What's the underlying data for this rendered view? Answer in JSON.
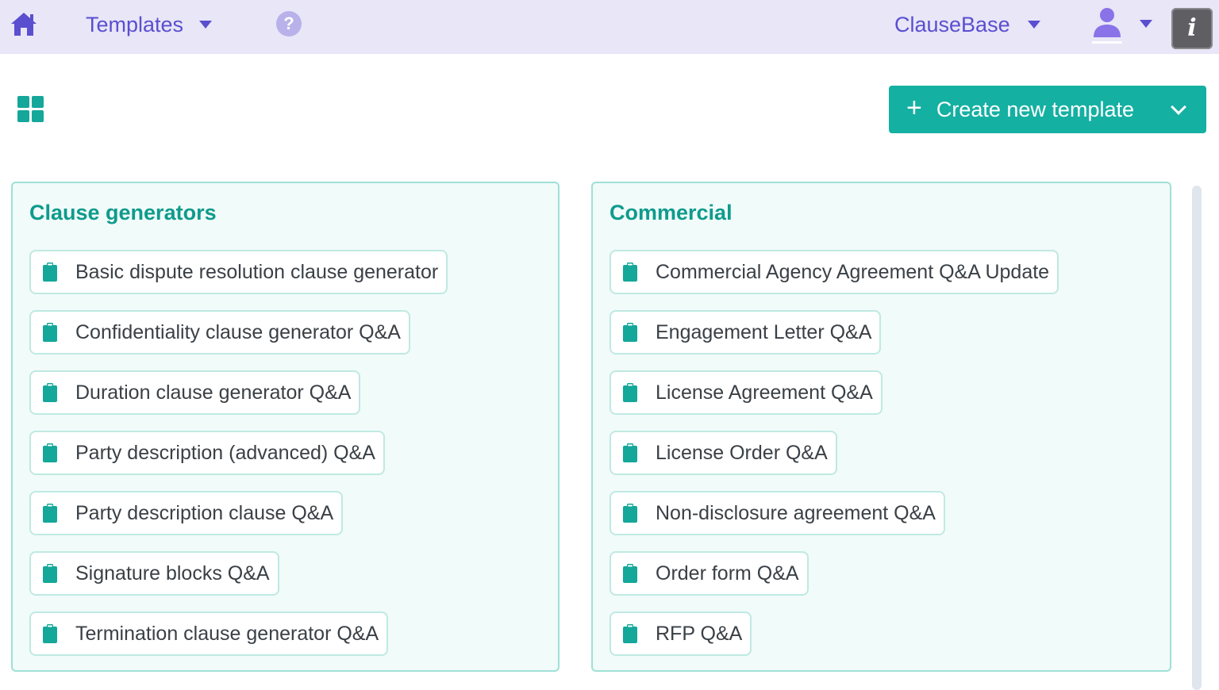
{
  "topbar": {
    "templates_label": "Templates",
    "help_label": "?",
    "workspace_label": "ClauseBase",
    "info_label": "i",
    "icons": {
      "home": "home-icon",
      "help": "question-circle-icon",
      "user": "user-icon",
      "info": "info-icon"
    }
  },
  "toolbar": {
    "create_label": "Create new template",
    "create_plus": "+",
    "view_icon": "grid-view-icon"
  },
  "colors": {
    "accent": "#14b0a2",
    "nav": "#5a4fcf",
    "topbar_bg": "#e8e6f7",
    "panel_bg": "#f1fbf9"
  },
  "panels": [
    {
      "title": "Clause generators",
      "items": [
        "Basic dispute resolution clause generator",
        "Confidentiality clause generator Q&A",
        "Duration clause generator Q&A",
        "Party description (advanced) Q&A",
        "Party description clause Q&A",
        "Signature blocks Q&A",
        "Termination clause generator Q&A"
      ]
    },
    {
      "title": "Commercial",
      "items": [
        "Commercial Agency Agreement Q&A Update",
        "Engagement Letter Q&A",
        "License Agreement Q&A",
        "License Order Q&A",
        "Non-disclosure agreement Q&A",
        "Order form Q&A",
        "RFP Q&A"
      ]
    }
  ]
}
